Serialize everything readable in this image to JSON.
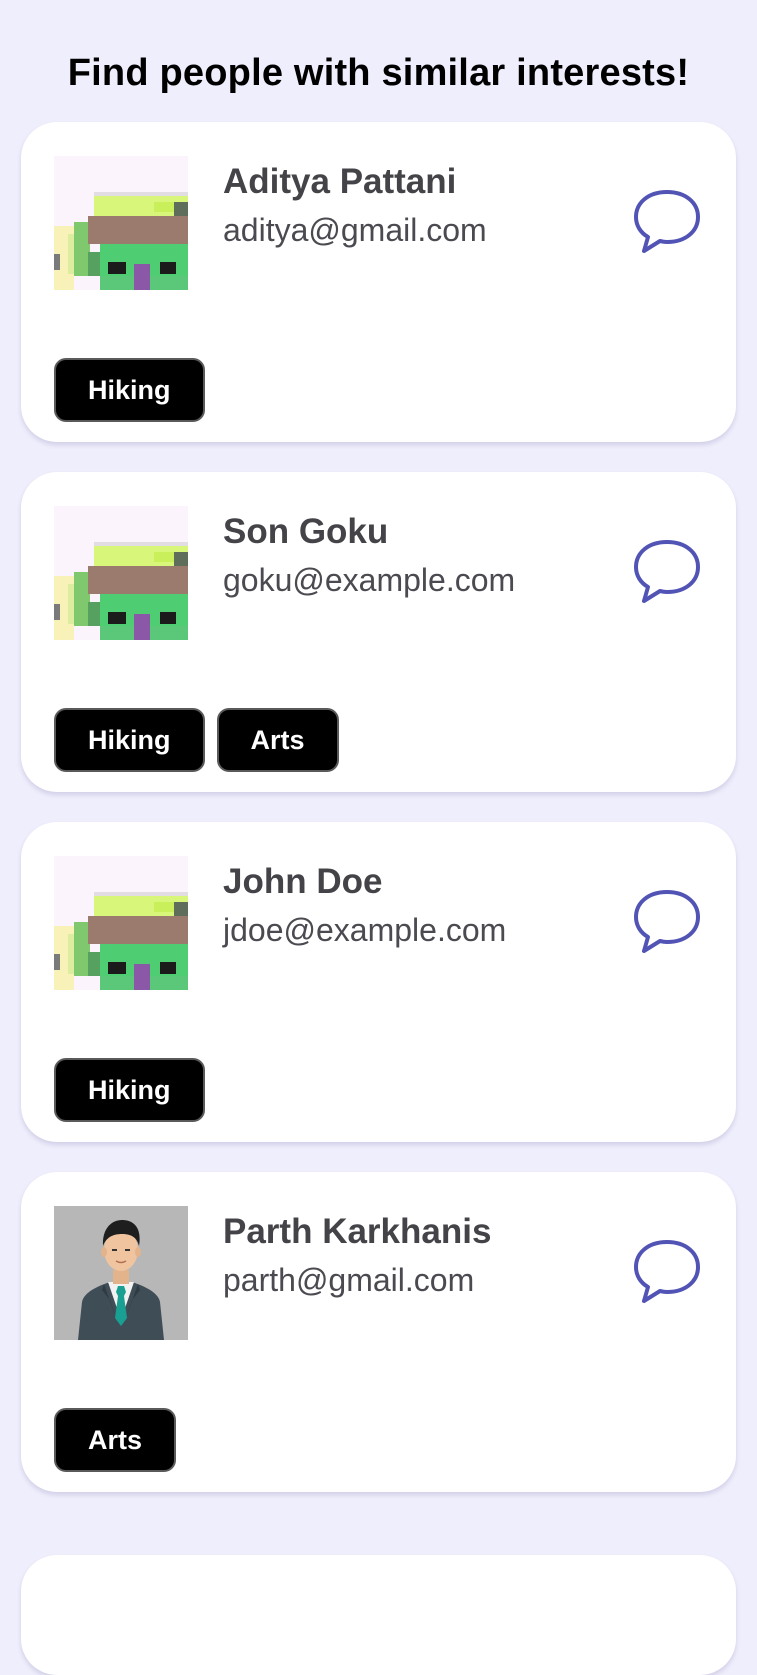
{
  "header": {
    "title": "Find people with similar interests!"
  },
  "users": [
    {
      "name": "Aditya Pattani",
      "email": "aditya@gmail.com",
      "avatar": "house-pixel-avatar",
      "interests": [
        "Hiking"
      ]
    },
    {
      "name": "Son Goku",
      "email": "goku@example.com",
      "avatar": "house-pixel-avatar",
      "interests": [
        "Hiking",
        "Arts"
      ]
    },
    {
      "name": "John Doe",
      "email": "jdoe@example.com",
      "avatar": "house-pixel-avatar",
      "interests": [
        "Hiking"
      ]
    },
    {
      "name": "Parth Karkhanis",
      "email": "parth@gmail.com",
      "avatar": "businessman-avatar",
      "interests": [
        "Arts"
      ]
    }
  ],
  "icons": {
    "chat": "chat-bubble-icon"
  },
  "colors": {
    "background": "#efeefc",
    "card": "#ffffff",
    "accent": "#5154b4",
    "tag_bg": "#000000",
    "tag_text": "#ffffff"
  }
}
